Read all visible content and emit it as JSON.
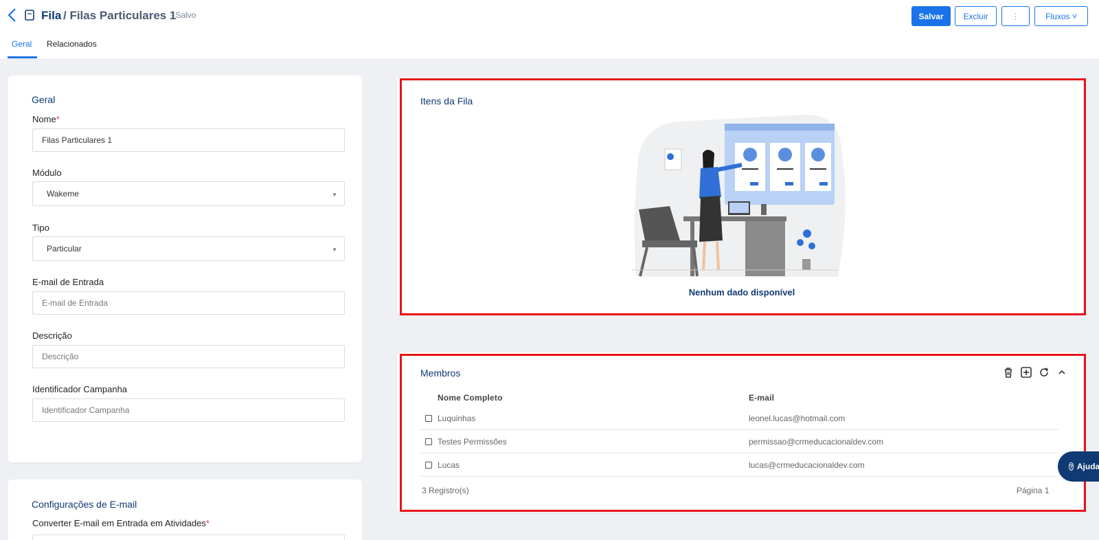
{
  "header": {
    "breadcrumb_root": "Fila",
    "breadcrumb_current": "/ Filas Particulares 1",
    "status": "- Salvo",
    "buttons": {
      "save": "Salvar",
      "delete": "Excluir",
      "more": "⋮",
      "flows": "Fluxos ˅"
    }
  },
  "tabs": [
    {
      "label": "Geral",
      "active": true
    },
    {
      "label": "Relacionados",
      "active": false
    }
  ],
  "general": {
    "title": "Geral",
    "name_label": "Nome",
    "name_value": "Filas Particulares 1",
    "module_label": "Módulo",
    "module_value": "Wakeme",
    "type_label": "Tipo",
    "type_value": "Particular",
    "inbound_email_label": "E-mail de Entrada",
    "inbound_email_placeholder": "E-mail de Entrada",
    "description_label": "Descrição",
    "description_placeholder": "Descrição",
    "campaign_label": "Identificador Campanha",
    "campaign_placeholder": "Identificador Campanha"
  },
  "email_config": {
    "title": "Configurações de E-mail",
    "convert_label": "Converter E-mail em Entrada em Atividades"
  },
  "queue_items": {
    "title": "Itens da Fila",
    "empty_text": "Nenhum dado disponível"
  },
  "members": {
    "title": "Membros",
    "columns": [
      "Nome Completo",
      "E-mail"
    ],
    "rows": [
      {
        "name": "Luquinhas",
        "email": "leonel.lucas@hotmail.com"
      },
      {
        "name": "Testes Permissões",
        "email": "permissao@crmeducacionaldev.com"
      },
      {
        "name": "Lucas",
        "email": "lucas@crmeducacionaldev.com"
      }
    ],
    "count": "3 Registro(s)",
    "page": "Página 1",
    "toolbar_icons": [
      "trash-icon",
      "add-box-icon",
      "refresh-icon",
      "collapse-icon"
    ]
  },
  "help": {
    "label": "Ajuda"
  },
  "colors": {
    "primary": "#1a73e8",
    "navy": "#0f3a73",
    "highlight": "#e8121a"
  }
}
